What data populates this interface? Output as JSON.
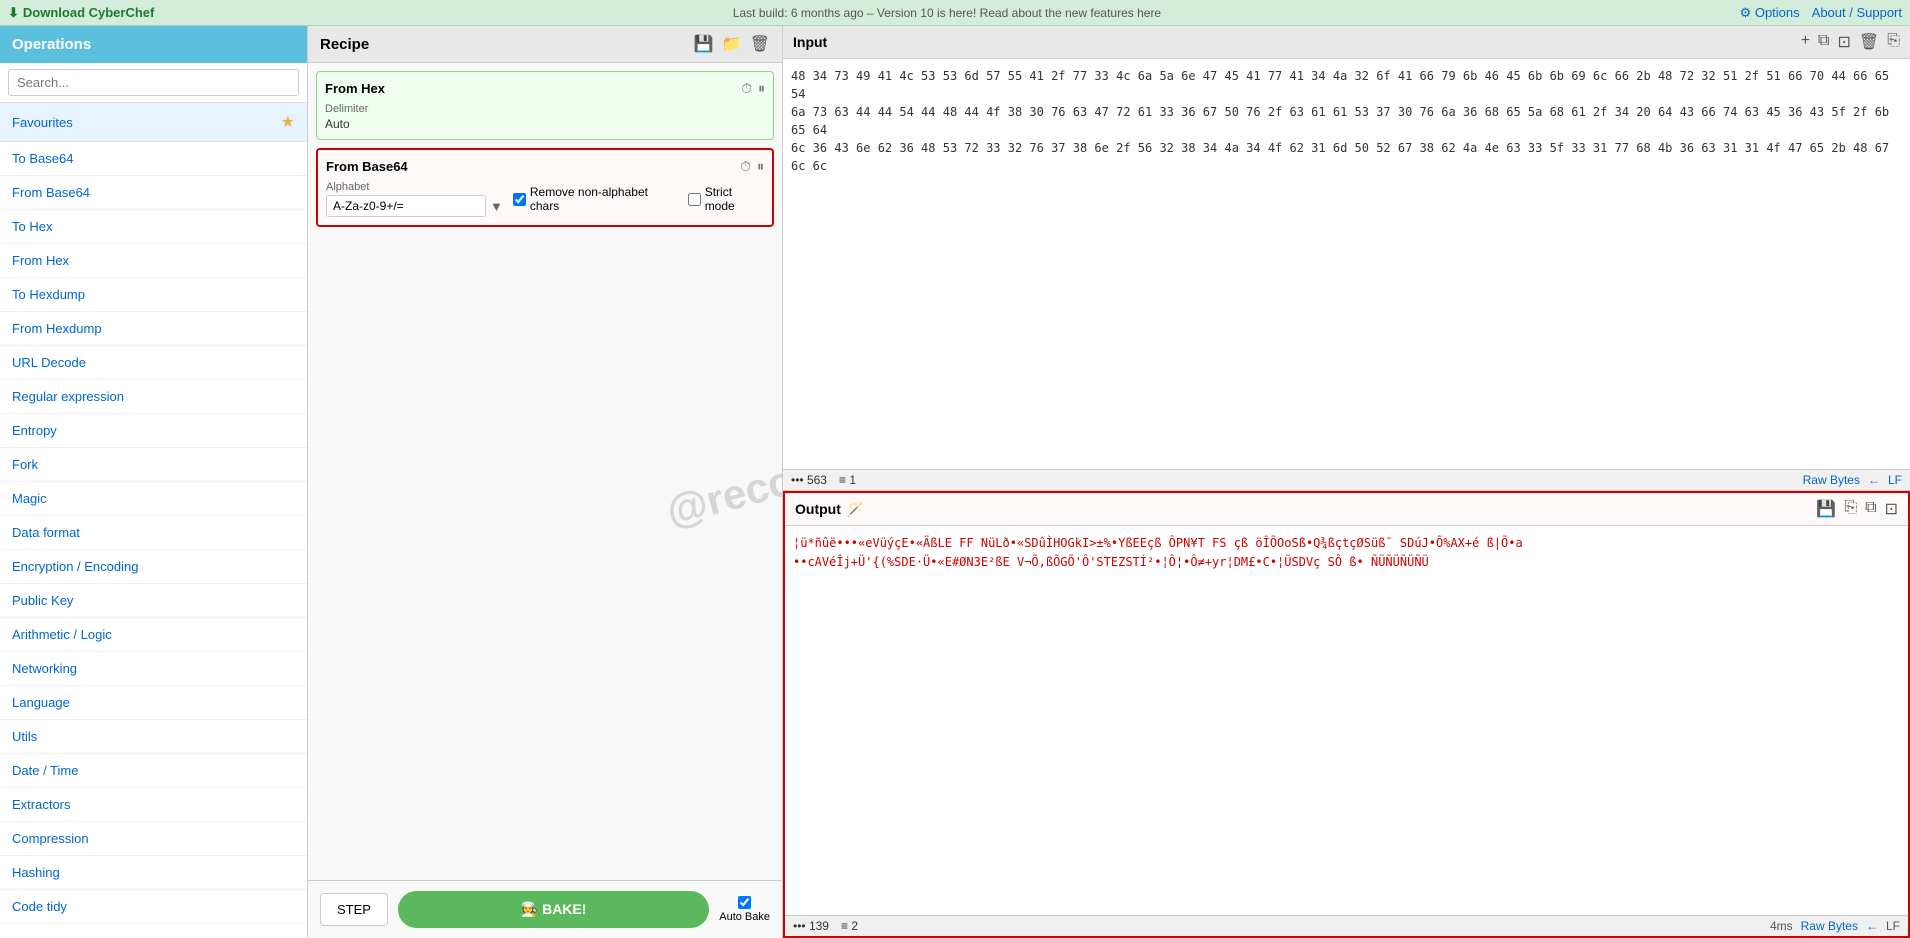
{
  "topbar": {
    "download_label": "Download CyberChef",
    "download_icon": "⬇",
    "center_text": "Last build: 6 months ago – Version 10 is here! Read about the new features here",
    "options_label": "Options",
    "options_icon": "⚙",
    "about_label": "About / Support"
  },
  "sidebar": {
    "header": "Operations",
    "search_placeholder": "Search...",
    "items": [
      {
        "label": "Favourites",
        "type": "favourites"
      },
      {
        "label": "To Base64"
      },
      {
        "label": "From Base64"
      },
      {
        "label": "To Hex"
      },
      {
        "label": "From Hex"
      },
      {
        "label": "To Hexdump"
      },
      {
        "label": "From Hexdump"
      },
      {
        "label": "URL Decode"
      },
      {
        "label": "Regular expression"
      },
      {
        "label": "Entropy"
      },
      {
        "label": "Fork"
      },
      {
        "label": "Magic"
      },
      {
        "label": "Data format"
      },
      {
        "label": "Encryption / Encoding"
      },
      {
        "label": "Public Key"
      },
      {
        "label": "Arithmetic / Logic"
      },
      {
        "label": "Networking"
      },
      {
        "label": "Language"
      },
      {
        "label": "Utils"
      },
      {
        "label": "Date / Time"
      },
      {
        "label": "Extractors"
      },
      {
        "label": "Compression"
      },
      {
        "label": "Hashing"
      },
      {
        "label": "Code tidy"
      }
    ]
  },
  "recipe": {
    "title": "Recipe",
    "save_icon": "💾",
    "folder_icon": "📁",
    "trash_icon": "🗑",
    "from_hex": {
      "title": "From Hex",
      "delimiter_label": "Delimiter",
      "delimiter_value": "Auto"
    },
    "from_base64": {
      "title": "From Base64",
      "alphabet_label": "Alphabet",
      "alphabet_value": "A-Za-z0-9+/=",
      "remove_nonalpha_label": "Remove non-alphabet chars",
      "remove_nonalpha_checked": true,
      "strict_mode_label": "Strict mode",
      "strict_mode_checked": false
    }
  },
  "bake": {
    "step_label": "STEP",
    "bake_label": "🧑‍🍳 BAKE!",
    "auto_bake_label": "Auto Bake",
    "auto_bake_checked": true
  },
  "input": {
    "title": "Input",
    "plus_icon": "+",
    "content": "48 34 73 49 41 4c 53 53 6d 57 55 41 2f 77 33 4c 6a 5a 6e 47 45 41 77 41 34 4a 32 6f 41 66 79 6b 46 45 6b 6b 69 6c 66 2b 48 72 32 51 2f 51 66 70 44 66 65 54\n6a 73 63 44 44 54 44 48 44 4f 38 30 76 63 47 72 61 33 36 67 50 76 2f 63 61 61 53 37 30 76 6a 36 68 65 5a 68 61 2f 34 20 64 43 66 74 63 45 36 43 5f 2f 6b 65 64\n6c 36 43 6e 62 36 48 53 72 33 32 76 37 38 6e 2f 56 32 38 34 4a 34 4f 62 31 6d 50 52 67 38 62 4a 4e 63 33 5f 33 31 77 68 4b 36 63 31 31 4f 47 65 2b 48 67 6c 6c"
  },
  "output": {
    "title": "Output",
    "wand_icon": "🪄",
    "statusbar_left_count": "563",
    "statusbar_left_lines": "1",
    "raw_bytes_label": "Raw Bytes",
    "lf_label": "LF",
    "content": "¦ü*ñûë•••«eVüýçE•«ÄßLE FF NüLð•«SDûÌHOGkI>±%•YßEEçß ÔPN¥T FS çß öÎÕOoSß•Q¾ßçtçØSüß¯ SDúJ•Õ%AX+é ß|Õ•a\n••cAVéÎj+Ü'{(%SDE·Ü•«E#ØN3E²ßE V¬Õ,ßÕGÕ'Ô'STEZSTÍ²•¦Ô¦•Ô≠+yr¦DM£•C•¦ÜSDVç SÔ ß• ÑÜÑÜÑÜÑÜ",
    "bottom_count": "139",
    "bottom_lines": "2"
  },
  "watermark": {
    "text": "@recordedparadox"
  }
}
